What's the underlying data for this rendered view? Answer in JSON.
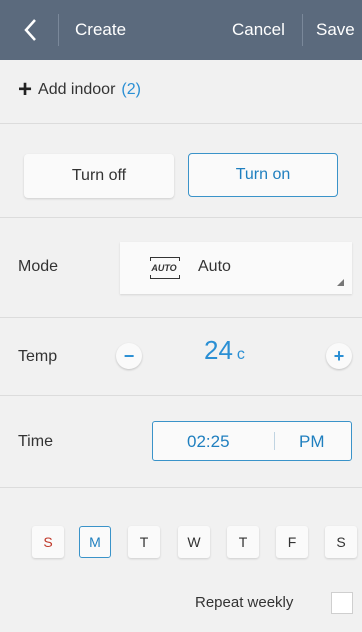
{
  "header": {
    "back_icon": "chevron-left-icon",
    "title": "Create",
    "cancel": "Cancel",
    "save": "Save"
  },
  "indoor": {
    "label": "Add indoor",
    "count": "(2)"
  },
  "power": {
    "off": "Turn off",
    "on": "Turn on",
    "selected": "on"
  },
  "mode": {
    "label": "Mode",
    "icon_text": "AUTO",
    "value": "Auto"
  },
  "temp": {
    "label": "Temp",
    "value": "24",
    "unit": "c"
  },
  "time": {
    "label": "Time",
    "value": "02:25",
    "period": "PM"
  },
  "days": [
    {
      "label": "S",
      "selected": false
    },
    {
      "label": "M",
      "selected": true
    },
    {
      "label": "T",
      "selected": false
    },
    {
      "label": "W",
      "selected": false
    },
    {
      "label": "T",
      "selected": false
    },
    {
      "label": "F",
      "selected": false
    },
    {
      "label": "S",
      "selected": false
    }
  ],
  "repeat": {
    "label": "Repeat weekly",
    "checked": false
  },
  "colors": {
    "header_bg": "#5b6a7d",
    "accent": "#2a8fd4",
    "sunday": "#c0392b"
  }
}
